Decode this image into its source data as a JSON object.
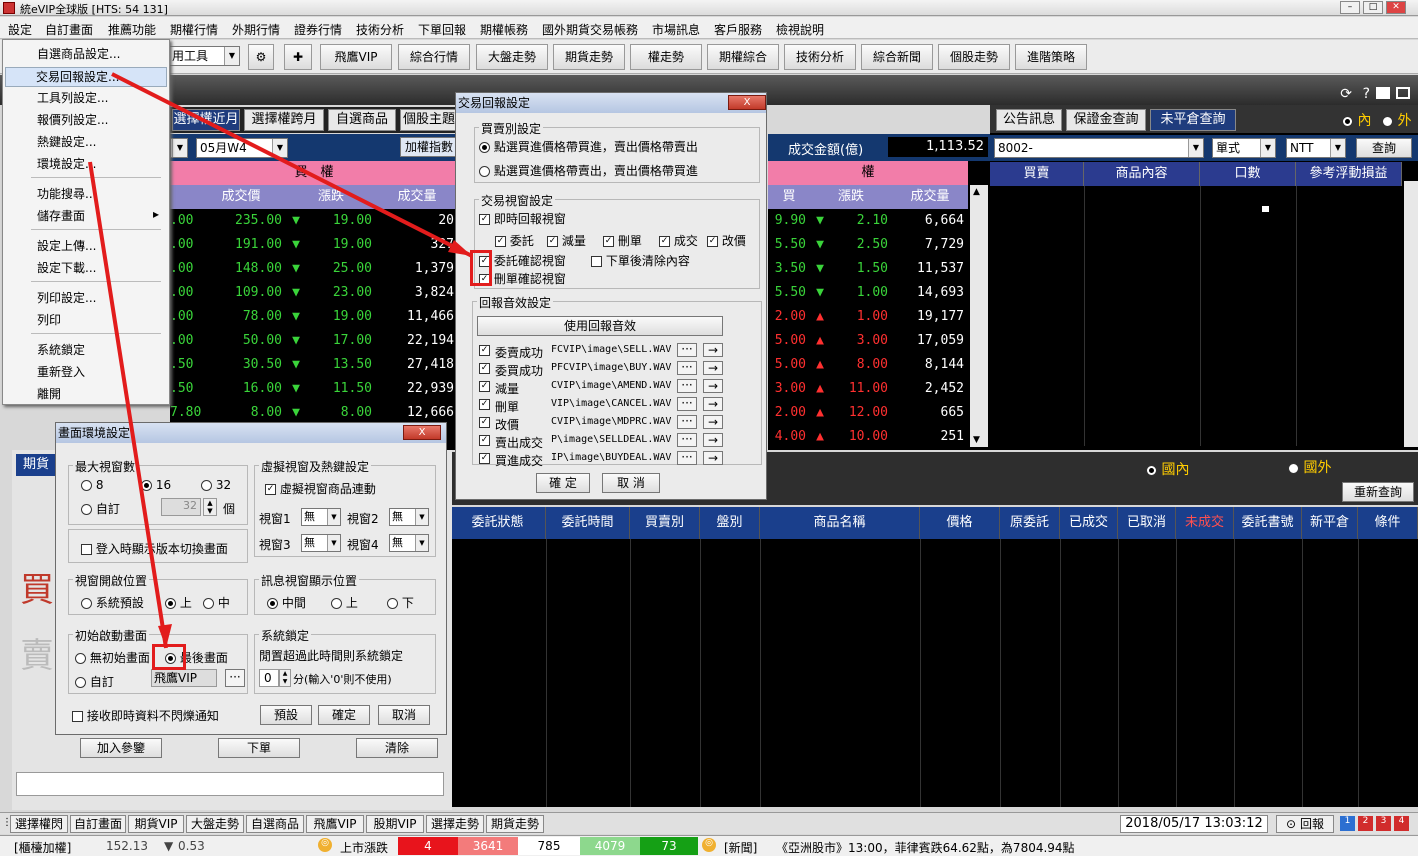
{
  "app": {
    "title": "統eVIP全球版 [HTS: 54 131]"
  },
  "menubar": [
    "設定",
    "自訂畫面",
    "推薦功能",
    "期權行情",
    "外期行情",
    "證券行情",
    "技術分析",
    "下單回報",
    "期權帳務",
    "國外期貨交易帳務",
    "市場訊息",
    "客戶服務",
    "檢視說明"
  ],
  "toolbar": {
    "combo": "用工具",
    "buttons": [
      "飛鷹VIP",
      "綜合行情",
      "大盤走勢",
      "期貨走勢",
      "權走勢",
      "期權綜合",
      "技術分析",
      "綜合新聞",
      "個股走勢",
      "進階策略"
    ]
  },
  "settings_menu": [
    "自選商品設定...",
    "交易回報設定...",
    "工具列設定...",
    "報價列設定...",
    "熱鍵設定...",
    "環境設定...",
    "功能搜尋...",
    "儲存畫面",
    "設定上傳...",
    "設定下載...",
    "列印設定...",
    "列印",
    "系統鎖定",
    "重新登入",
    "離開"
  ],
  "left_tabs": [
    "選擇權近月",
    "選擇權跨月",
    "自選商品",
    "個股主題"
  ],
  "left_combo": "05月W4",
  "left_button": "加權指數",
  "left_grid": {
    "title": "買　權",
    "cols": [
      "成交價",
      "漲跌",
      "成交量"
    ],
    "rows": [
      {
        "pre": ".00",
        "price": "235.00",
        "chg": "19.00",
        "vol": "20"
      },
      {
        "pre": ".00",
        "price": "191.00",
        "chg": "19.00",
        "vol": "327"
      },
      {
        "pre": ".00",
        "price": "148.00",
        "chg": "25.00",
        "vol": "1,379"
      },
      {
        "pre": ".00",
        "price": "109.00",
        "chg": "23.00",
        "vol": "3,824"
      },
      {
        "pre": ".00",
        "price": "78.00",
        "chg": "19.00",
        "vol": "11,466"
      },
      {
        "pre": ".00",
        "price": "50.00",
        "chg": "17.00",
        "vol": "22,194"
      },
      {
        "pre": ".50",
        "price": "30.50",
        "chg": "13.50",
        "vol": "27,418"
      },
      {
        "pre": ".50",
        "price": "16.00",
        "chg": "11.50",
        "vol": "22,939"
      },
      {
        "pre": "7.80",
        "price": "8.00",
        "chg": "8.00",
        "vol": "12,666"
      }
    ]
  },
  "mid_grid": {
    "amount_label": "成交金額(億)",
    "amount": "1,113.52",
    "title": "權",
    "cols": [
      "買",
      "漲跌",
      "成交量"
    ],
    "rows": [
      {
        "pre": "9.90",
        "chg": "2.10",
        "vol": "6,664",
        "up": false
      },
      {
        "pre": "5.50",
        "chg": "2.50",
        "vol": "7,729",
        "up": false
      },
      {
        "pre": "3.50",
        "chg": "1.50",
        "vol": "11,537",
        "up": false
      },
      {
        "pre": "5.50",
        "chg": "1.00",
        "vol": "14,693",
        "up": false
      },
      {
        "pre": "2.00",
        "chg": "1.00",
        "vol": "19,177",
        "up": true
      },
      {
        "pre": "5.00",
        "chg": "3.00",
        "vol": "17,059",
        "up": true
      },
      {
        "pre": "5.00",
        "chg": "8.00",
        "vol": "8,144",
        "up": true
      },
      {
        "pre": "3.00",
        "chg": "11.00",
        "vol": "2,452",
        "up": true
      },
      {
        "pre": "2.00",
        "chg": "12.00",
        "vol": "665",
        "up": true
      },
      {
        "pre": "4.00",
        "chg": "10.00",
        "vol": "251",
        "up": true
      }
    ]
  },
  "right_panel": {
    "tabs": [
      "公告訊息",
      "保證金查詢",
      "未平倉查詢"
    ],
    "radio_in": "內",
    "radio_out": "外",
    "account": "8002-",
    "mode": "單式",
    "currency": "NTT",
    "query": "查詢",
    "cols": [
      "買賣",
      "商品內容",
      "口數",
      "參考浮動損益"
    ]
  },
  "bottom_panel": {
    "radio_domestic": "國內",
    "radio_foreign": "國外",
    "refresh": "重新查詢",
    "cols": [
      "委託狀態",
      "委託時間",
      "買賣別",
      "盤別",
      "商品名稱",
      "價格",
      "原委託",
      "已成交",
      "已取消",
      "未成交",
      "委託書號",
      "新平倉",
      "條件"
    ]
  },
  "left_lower": {
    "tab": "期貨",
    "buy": "買",
    "sell": "賣",
    "buttons": [
      "加入參鑒",
      "下單",
      "清除"
    ]
  },
  "env_dialog": {
    "title": "畫面環境設定",
    "close": "X",
    "max_windows_label": "最大視窗數",
    "opt_8": "8",
    "opt_16": "16",
    "opt_32": "32",
    "opt_custom": "自訂",
    "custom_value": "32",
    "unit": "個",
    "virtual_label": "虛擬視窗及熱鍵設定",
    "virtual_link": "虛擬視窗商品連動",
    "vw1": "視窗1",
    "vw2": "視窗2",
    "vw3": "視窗3",
    "vw4": "視窗4",
    "none": "無",
    "login_switch": "登入時顯示版本切換畫面",
    "pos_label": "視窗開啟位置",
    "pos_default": "系統預設",
    "pos_top": "上",
    "pos_mid": "中",
    "msg_label": "訊息視窗顯示位置",
    "msg_mid": "中間",
    "msg_top": "上",
    "msg_bottom": "下",
    "startup_label": "初始啟動畫面",
    "startup_none": "無初始畫面",
    "startup_last": "最後畫面",
    "startup_custom": "自訂",
    "startup_custom_value": "飛鷹VIP",
    "lock_label": "系統鎖定",
    "lock_desc": "閒置超過此時間則系統鎖定",
    "lock_value": "0",
    "lock_unit": "分(輸入'0'則不使用)",
    "no_flash": "接收即時資料不閃爍通知",
    "btn_default": "預設",
    "btn_ok": "確定",
    "btn_cancel": "取消"
  },
  "trade_dialog": {
    "title": "交易回報設定",
    "close": "X",
    "buysell_label": "買賣別設定",
    "bs_opt1": "點選買進價格帶買進，賣出價格帶賣出",
    "bs_opt2": "點選買進價格帶賣出，賣出價格帶買進",
    "window_label": "交易視窗設定",
    "realtime": "即時回報視窗",
    "sub": [
      "委託",
      "減量",
      "刪單",
      "成交",
      "改價"
    ],
    "confirm_order": "委託確認視窗",
    "clear_after": "下單後清除內容",
    "confirm_delete": "刪單確認視窗",
    "sound_label": "回報音效設定",
    "use_sound": "使用回報音效",
    "sounds": [
      {
        "name": "委賣成功",
        "path": "FCVIP\\image\\SELL.WAV"
      },
      {
        "name": "委買成功",
        "path": "PFCVIP\\image\\BUY.WAV"
      },
      {
        "name": "減量",
        "path": "CVIP\\image\\AMEND.WAV"
      },
      {
        "name": "刪單",
        "path": "VIP\\image\\CANCEL.WAV"
      },
      {
        "name": "改價",
        "path": "CVIP\\image\\MDPRC.WAV"
      },
      {
        "name": "賣出成交",
        "path": "P\\image\\SELLDEAL.WAV"
      },
      {
        "name": "買進成交",
        "path": "IP\\image\\BUYDEAL.WAV"
      }
    ],
    "browse": "···",
    "play": "→",
    "btn_ok": "確 定",
    "btn_cancel": "取 消"
  },
  "statusbar": {
    "buttons": [
      "選擇權閃",
      "自訂畫面",
      "期貨VIP",
      "大盤走勢",
      "自選商品",
      "飛鷹VIP",
      "股期VIP",
      "選擇走勢",
      "期貨走勢"
    ],
    "datetime": "2018/05/17 13:03:12",
    "report": "回報"
  },
  "ticker": {
    "index_label": "[櫃檯加權]",
    "index_value": "152.13",
    "index_change": "0.53",
    "market_label": "上市漲跌",
    "up_count": "4",
    "up_count2": "3641",
    "flat": "785",
    "down_count": "4079",
    "down_count2": "73",
    "news_label": "[新聞]",
    "news": "《亞洲股市》13:00，菲律賓跌64.62點，為7804.94點"
  },
  "colors": {
    "accent": "#1a55b0",
    "highlight": "#e21c1c",
    "up": "#ff3030",
    "down": "#3ad43a"
  }
}
